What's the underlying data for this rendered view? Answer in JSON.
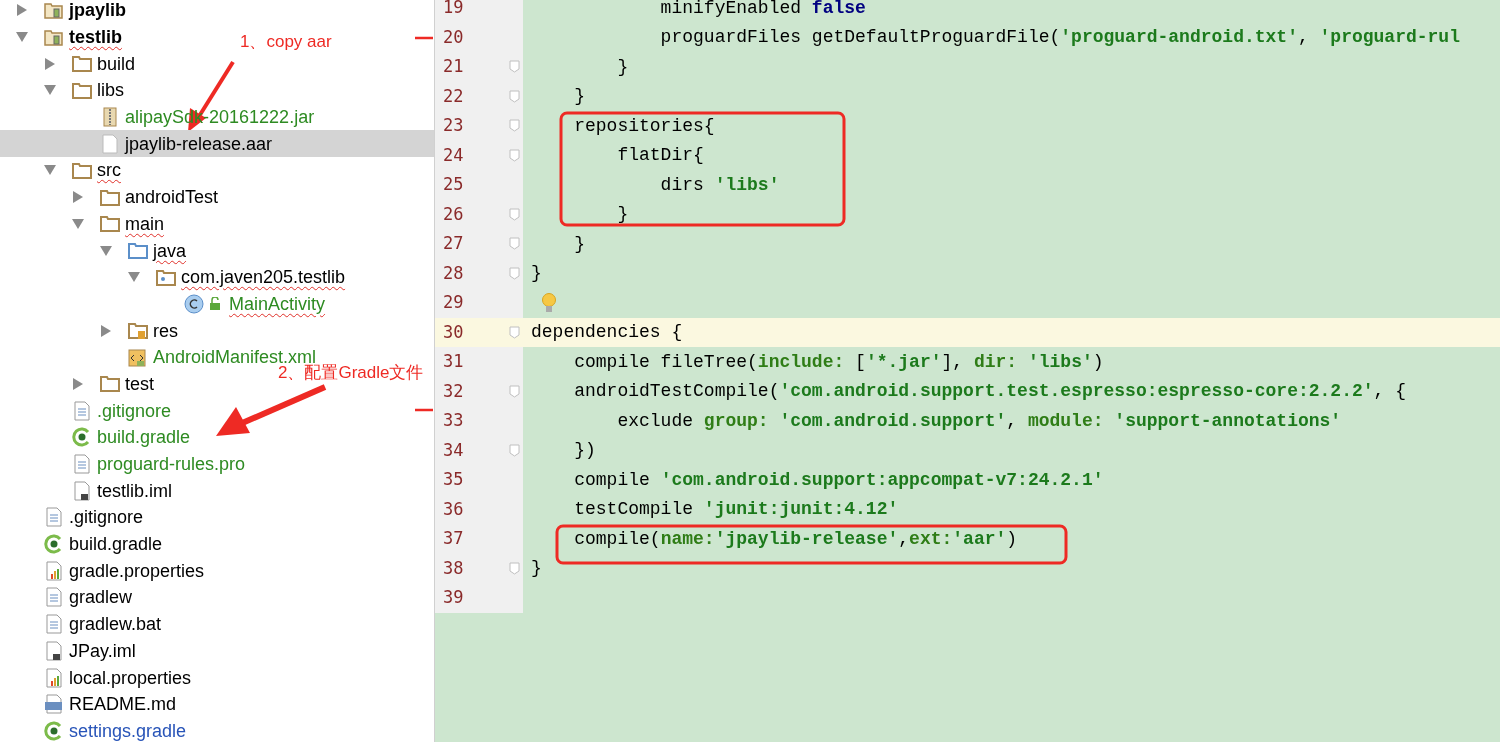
{
  "project_tree": [
    {
      "label": "jpaylib",
      "kind": "module",
      "expanded": false,
      "selected": false,
      "color": "#000000",
      "wavy_underline": false
    },
    {
      "label": "testlib",
      "kind": "module",
      "expanded": true,
      "selected": false,
      "color": "#000000",
      "wavy_underline": true,
      "children": [
        {
          "label": "build",
          "kind": "folder",
          "expanded": false,
          "selected": false,
          "color": "#000000",
          "wavy_underline": false
        },
        {
          "label": "libs",
          "kind": "folder",
          "expanded": true,
          "selected": false,
          "color": "#000000",
          "wavy_underline": false,
          "children": [
            {
              "label": "alipaySdk-20161222.jar",
              "kind": "jar",
              "selected": false,
              "color": "#2e8b22",
              "wavy_underline": false
            },
            {
              "label": "jpaylib-release.aar",
              "kind": "file",
              "selected": true,
              "color": "#000000",
              "wavy_underline": false
            }
          ]
        },
        {
          "label": "src",
          "kind": "folder",
          "expanded": true,
          "selected": false,
          "color": "#000000",
          "wavy_underline": true,
          "children": [
            {
              "label": "androidTest",
              "kind": "folder",
              "expanded": false,
              "selected": false,
              "color": "#000000",
              "wavy_underline": false
            },
            {
              "label": "main",
              "kind": "folder",
              "expanded": true,
              "selected": false,
              "color": "#000000",
              "wavy_underline": true,
              "children": [
                {
                  "label": "java",
                  "kind": "source_folder",
                  "expanded": true,
                  "selected": false,
                  "color": "#000000",
                  "wavy_underline": true,
                  "children": [
                    {
                      "label": "com.javen205.testlib",
                      "kind": "package",
                      "expanded": true,
                      "selected": false,
                      "color": "#000000",
                      "wavy_underline": true,
                      "children": [
                        {
                          "label": "MainActivity",
                          "kind": "class",
                          "selected": false,
                          "color": "#2e8b22",
                          "wavy_underline": true
                        }
                      ]
                    }
                  ]
                },
                {
                  "label": "res",
                  "kind": "resource_folder",
                  "expanded": false,
                  "selected": false,
                  "color": "#000000",
                  "wavy_underline": false
                },
                {
                  "label": "AndroidManifest.xml",
                  "kind": "manifest",
                  "selected": false,
                  "color": "#2e8b22",
                  "wavy_underline": false
                }
              ]
            },
            {
              "label": "test",
              "kind": "folder",
              "expanded": false,
              "selected": false,
              "color": "#000000",
              "wavy_underline": false
            }
          ]
        },
        {
          "label": ".gitignore",
          "kind": "text",
          "selected": false,
          "color": "#2e8b22",
          "wavy_underline": false
        },
        {
          "label": "build.gradle",
          "kind": "gradle",
          "selected": false,
          "color": "#2e8b22",
          "wavy_underline": false
        },
        {
          "label": "proguard-rules.pro",
          "kind": "text",
          "selected": false,
          "color": "#2e8b22",
          "wavy_underline": false
        },
        {
          "label": "testlib.iml",
          "kind": "iml",
          "selected": false,
          "color": "#000000",
          "wavy_underline": false
        }
      ]
    },
    {
      "label": ".gitignore",
      "kind": "text",
      "selected": false,
      "color": "#000000",
      "wavy_underline": false
    },
    {
      "label": "build.gradle",
      "kind": "gradle",
      "selected": false,
      "color": "#000000",
      "wavy_underline": false
    },
    {
      "label": "gradle.properties",
      "kind": "properties",
      "selected": false,
      "color": "#000000",
      "wavy_underline": false
    },
    {
      "label": "gradlew",
      "kind": "text",
      "selected": false,
      "color": "#000000",
      "wavy_underline": false
    },
    {
      "label": "gradlew.bat",
      "kind": "text",
      "selected": false,
      "color": "#000000",
      "wavy_underline": false
    },
    {
      "label": "JPay.iml",
      "kind": "iml",
      "selected": false,
      "color": "#000000",
      "wavy_underline": false
    },
    {
      "label": "local.properties",
      "kind": "properties",
      "selected": false,
      "color": "#000000",
      "wavy_underline": false
    },
    {
      "label": "README.md",
      "kind": "markdown",
      "selected": false,
      "color": "#000000",
      "wavy_underline": false
    },
    {
      "label": "settings.gradle",
      "kind": "gradle",
      "selected": false,
      "color": "#2854b8",
      "wavy_underline": false
    }
  ],
  "editor_lines": [
    {
      "number": "19",
      "foldable": false,
      "bulb": false,
      "current": false,
      "segments": [
        {
          "text": "            minifyEnabled ",
          "kind": "plain"
        },
        {
          "text": "false",
          "kind": "keyword"
        }
      ]
    },
    {
      "number": "20",
      "foldable": false,
      "bulb": false,
      "current": false,
      "segments": [
        {
          "text": "            proguardFiles getDefaultProguardFile(",
          "kind": "plain"
        },
        {
          "text": "'proguard-android.txt'",
          "kind": "string"
        },
        {
          "text": ", ",
          "kind": "plain"
        },
        {
          "text": "'proguard-rul",
          "kind": "string"
        }
      ]
    },
    {
      "number": "21",
      "foldable": true,
      "bulb": false,
      "current": false,
      "segments": [
        {
          "text": "        }",
          "kind": "plain"
        }
      ]
    },
    {
      "number": "22",
      "foldable": true,
      "bulb": false,
      "current": false,
      "segments": [
        {
          "text": "    }",
          "kind": "plain"
        }
      ]
    },
    {
      "number": "23",
      "foldable": true,
      "bulb": false,
      "current": false,
      "segments": [
        {
          "text": "    repositories{",
          "kind": "plain"
        }
      ]
    },
    {
      "number": "24",
      "foldable": true,
      "bulb": false,
      "current": false,
      "segments": [
        {
          "text": "        flatDir{",
          "kind": "plain"
        }
      ]
    },
    {
      "number": "25",
      "foldable": false,
      "bulb": false,
      "current": false,
      "segments": [
        {
          "text": "            dirs ",
          "kind": "plain"
        },
        {
          "text": "'libs'",
          "kind": "string"
        }
      ]
    },
    {
      "number": "26",
      "foldable": true,
      "bulb": false,
      "current": false,
      "segments": [
        {
          "text": "        }",
          "kind": "plain"
        }
      ]
    },
    {
      "number": "27",
      "foldable": true,
      "bulb": false,
      "current": false,
      "segments": [
        {
          "text": "    }",
          "kind": "plain"
        }
      ]
    },
    {
      "number": "28",
      "foldable": true,
      "bulb": false,
      "current": false,
      "segments": [
        {
          "text": "}",
          "kind": "plain"
        }
      ]
    },
    {
      "number": "29",
      "foldable": false,
      "bulb": true,
      "current": false
    },
    {
      "number": "30",
      "foldable": true,
      "bulb": false,
      "current": true,
      "segments": [
        {
          "text": "dependencies {",
          "kind": "plain"
        }
      ]
    },
    {
      "number": "31",
      "foldable": false,
      "bulb": false,
      "current": false,
      "segments": [
        {
          "text": "    compile fileTree(",
          "kind": "plain"
        },
        {
          "text": "include: ",
          "kind": "named"
        },
        {
          "text": "[",
          "kind": "plain"
        },
        {
          "text": "'*.jar'",
          "kind": "string"
        },
        {
          "text": "], ",
          "kind": "plain"
        },
        {
          "text": "dir: ",
          "kind": "named"
        },
        {
          "text": "'libs'",
          "kind": "string"
        },
        {
          "text": ")",
          "kind": "plain"
        }
      ]
    },
    {
      "number": "32",
      "foldable": true,
      "bulb": false,
      "current": false,
      "segments": [
        {
          "text": "    androidTestCompile(",
          "kind": "plain"
        },
        {
          "text": "'com.android.support.test.espresso:espresso-core:2.2.2'",
          "kind": "string"
        },
        {
          "text": ", {",
          "kind": "plain"
        }
      ]
    },
    {
      "number": "33",
      "foldable": false,
      "bulb": false,
      "current": false,
      "segments": [
        {
          "text": "        exclude ",
          "kind": "plain"
        },
        {
          "text": "group: ",
          "kind": "named"
        },
        {
          "text": "'com.android.support'",
          "kind": "string"
        },
        {
          "text": ", ",
          "kind": "plain"
        },
        {
          "text": "module: ",
          "kind": "named"
        },
        {
          "text": "'support-annotations'",
          "kind": "string"
        }
      ]
    },
    {
      "number": "34",
      "foldable": true,
      "bulb": false,
      "current": false,
      "segments": [
        {
          "text": "    })",
          "kind": "plain"
        }
      ]
    },
    {
      "number": "35",
      "foldable": false,
      "bulb": false,
      "current": false,
      "segments": [
        {
          "text": "    compile ",
          "kind": "plain"
        },
        {
          "text": "'com.android.support:appcompat-v7:24.2.1'",
          "kind": "string"
        }
      ]
    },
    {
      "number": "36",
      "foldable": false,
      "bulb": false,
      "current": false,
      "segments": [
        {
          "text": "    testCompile ",
          "kind": "plain"
        },
        {
          "text": "'junit:junit:4.12'",
          "kind": "string"
        }
      ]
    },
    {
      "number": "37",
      "foldable": false,
      "bulb": false,
      "current": false,
      "segments": [
        {
          "text": "    compile(",
          "kind": "plain"
        },
        {
          "text": "name:",
          "kind": "named"
        },
        {
          "text": "'jpaylib-release'",
          "kind": "string"
        },
        {
          "text": ",",
          "kind": "plain"
        },
        {
          "text": "ext:",
          "kind": "named"
        },
        {
          "text": "'aar'",
          "kind": "string"
        },
        {
          "text": ")",
          "kind": "plain"
        }
      ]
    },
    {
      "number": "38",
      "foldable": true,
      "bulb": false,
      "current": false,
      "segments": [
        {
          "text": "}",
          "kind": "plain"
        }
      ]
    },
    {
      "number": "39",
      "foldable": false,
      "bulb": false,
      "current": false
    }
  ],
  "annotations": [
    {
      "text": "1、copy aar"
    },
    {
      "text": "2、配置Gradle文件"
    }
  ]
}
